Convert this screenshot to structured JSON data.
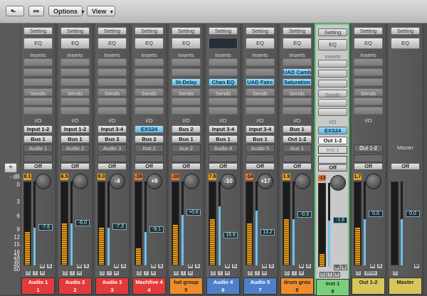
{
  "toolbar": {
    "back_icon": "back-arrow-icon",
    "link_icon": "link-icon",
    "options_label": "Options",
    "view_label": "View"
  },
  "scale": [
    "- dB",
    "0",
    "3",
    "6",
    "9",
    "12",
    "15",
    "18",
    "24",
    "30",
    "40",
    "60"
  ],
  "labels": {
    "setting": "Setting",
    "eq": "EQ",
    "inserts": "Inserts",
    "sends": "Sends",
    "io": "I/O",
    "off": "Off"
  },
  "strips": [
    {
      "name": "Audio 1",
      "peak": "8.1",
      "pan": "",
      "volume": "-7.6",
      "input": "Input 1-2",
      "output": "Bus 1",
      "inserts": [],
      "label": "Audio 1",
      "number": "1",
      "color": "#e33b3b",
      "text_color": "#ffffff"
    },
    {
      "name": "Audio 2",
      "peak": "6.5",
      "pan": "",
      "volume": "-6.0",
      "input": "Input 1-2",
      "output": "Bus 1",
      "inserts": [],
      "label": "Audio 2",
      "number": "2",
      "color": "#e33b3b",
      "text_color": "#ffffff"
    },
    {
      "name": "Audio 3",
      "peak": "9.0",
      "pan": "-4",
      "volume": "-7.3",
      "input": "Input 3-4",
      "output": "Bus 2",
      "inserts": [],
      "label": "Audio 3",
      "number": "3",
      "color": "#e33b3b",
      "text_color": "#ffffff"
    },
    {
      "name": "Inst 2",
      "peak": "-16",
      "pan": "+9",
      "volume": "-9.1",
      "input": "EXS24",
      "output": "Bus 2",
      "inserts": [],
      "label": "Machfive 4",
      "number": "4",
      "color": "#e33b3b",
      "text_color": "#ffffff"
    },
    {
      "name": "Aux 2",
      "peak": "-10",
      "pan": "",
      "volume": "+0.6",
      "input": "Bus 2",
      "output": "Bus 1",
      "inserts": [
        "St-Delay"
      ],
      "label": "hat group",
      "number": "5",
      "color": "#ef8d2c",
      "text_color": "#222222"
    },
    {
      "name": "Audio 4",
      "peak": "7.8",
      "pan": "-10",
      "volume": "15.9",
      "input": "Input 3-4",
      "output": "Bus 1",
      "inserts": [
        "Chan EQ"
      ],
      "label": "Audio 4",
      "number": "6",
      "color": "#4f7fc9",
      "text_color": "#ffffff"
    },
    {
      "name": "Audio 5",
      "peak": "-14",
      "pan": "+17",
      "volume": "13.2",
      "input": "Input 3-4",
      "output": "Bus 1",
      "inserts": [
        "UAD Fairc"
      ],
      "label": "Audio 5",
      "number": "7",
      "color": "#4f7fc9",
      "text_color": "#ffffff"
    },
    {
      "name": "Aux 1",
      "peak": "1.9",
      "pan": "",
      "volume": "-0.3",
      "input": "Bus 1",
      "output": "Out 1-2",
      "inserts": [
        "UAD Camb",
        "Saturation"
      ],
      "label": "drum grou",
      "number": "8",
      "color": "#ef8d2c",
      "text_color": "#222222"
    },
    {
      "name": "Inst 1",
      "peak": "-13",
      "pan": "",
      "volume": "-1.6",
      "input": "EXS24",
      "output": "Out 1-2",
      "inserts": [],
      "label": "Inst 1",
      "number": "9",
      "color": "#79d07a",
      "text_color": "#222222"
    },
    {
      "name": "Out 1-2",
      "peak": "1.7",
      "pan": "",
      "volume": "0.0",
      "input": "",
      "output": "",
      "inserts": [],
      "label": "Out 1-2",
      "number": "",
      "color": "#d7c65c",
      "text_color": "#222222"
    },
    {
      "name": "Master",
      "peak": "",
      "pan": "",
      "volume": "0.0",
      "input": "",
      "output": "",
      "inserts": [],
      "label": "Master",
      "number": "",
      "color": "#d7c65c",
      "text_color": "#222222"
    }
  ],
  "buttons": {
    "mute": "M",
    "solo": "S",
    "record": "R",
    "input": "I",
    "bounce": "Bnce"
  },
  "colors": {
    "selected_outline": "#5fd27b",
    "insert_blue": "#5bb9e4",
    "meter": "#e09b1a",
    "fader": "#6fbfe8"
  }
}
